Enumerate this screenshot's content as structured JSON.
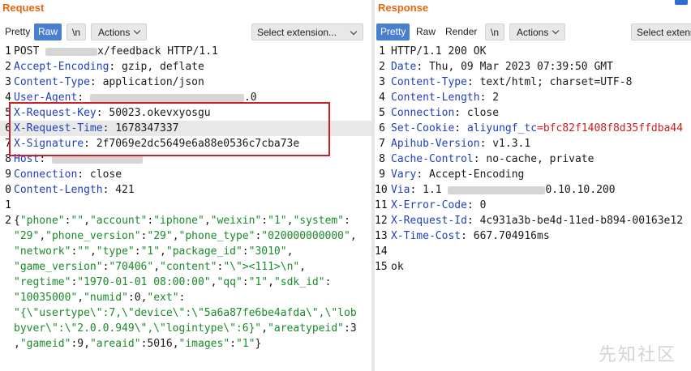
{
  "request": {
    "title": "Request",
    "tabs": [
      "Pretty",
      "Raw",
      "\\n"
    ],
    "active_tab": "Raw",
    "actions_label": "Actions",
    "select_extension": "Select extension...",
    "lines": [
      {
        "n": "1",
        "segments": [
          {
            "t": "POST ",
            "c": "hv"
          },
          {
            "t": "",
            "c": "redact",
            "w": 64
          },
          {
            "t": "x/feedback HTTP/1.1",
            "c": "hv"
          }
        ]
      },
      {
        "n": "2",
        "segments": [
          {
            "t": "Accept-Encoding",
            "c": "hk"
          },
          {
            "t": ": gzip, deflate",
            "c": "hv"
          }
        ]
      },
      {
        "n": "3",
        "segments": [
          {
            "t": "Content-Type",
            "c": "hk"
          },
          {
            "t": ": application/json",
            "c": "hv"
          }
        ]
      },
      {
        "n": "4",
        "segments": [
          {
            "t": "User-Agent",
            "c": "hk"
          },
          {
            "t": ": ",
            "c": "hv"
          },
          {
            "t": "",
            "c": "redact",
            "w": 190
          },
          {
            "t": ".0",
            "c": "hv"
          }
        ]
      },
      {
        "n": "5",
        "segments": [
          {
            "t": "X-Request-Key",
            "c": "hk"
          },
          {
            "t": ": 50023.okevxyosgu",
            "c": "hv"
          }
        ]
      },
      {
        "n": "6",
        "hl": true,
        "segments": [
          {
            "t": "X-Request-Time",
            "c": "hk"
          },
          {
            "t": ": 1678347337",
            "c": "hv"
          }
        ]
      },
      {
        "n": "7",
        "segments": [
          {
            "t": "X-Signature",
            "c": "hk"
          },
          {
            "t": ": 2f7069e2dc5649e6a88e0536c7cba73e",
            "c": "hv"
          }
        ]
      },
      {
        "n": "8",
        "segments": [
          {
            "t": "Host",
            "c": "hk"
          },
          {
            "t": ": ",
            "c": "hv"
          },
          {
            "t": "",
            "c": "redact",
            "w": 112
          }
        ]
      },
      {
        "n": "9",
        "segments": [
          {
            "t": "Connection",
            "c": "hk"
          },
          {
            "t": ": close",
            "c": "hv"
          }
        ]
      },
      {
        "n": "0",
        "segments": [
          {
            "t": "Content-Length",
            "c": "hk"
          },
          {
            "t": ": 421",
            "c": "hv"
          }
        ]
      },
      {
        "n": "1",
        "segments": []
      },
      {
        "n": "2",
        "segments": [
          {
            "t": "{",
            "c": "jp"
          },
          {
            "t": "\"phone\"",
            "c": "jk"
          },
          {
            "t": ":",
            "c": "jp"
          },
          {
            "t": "\"\"",
            "c": "js"
          },
          {
            "t": ",",
            "c": "jp"
          },
          {
            "t": "\"account\"",
            "c": "jk"
          },
          {
            "t": ":",
            "c": "jp"
          },
          {
            "t": "\"iphone\"",
            "c": "js"
          },
          {
            "t": ",",
            "c": "jp"
          },
          {
            "t": "\"weixin\"",
            "c": "jk"
          },
          {
            "t": ":",
            "c": "jp"
          },
          {
            "t": "\"1\"",
            "c": "js"
          },
          {
            "t": ",",
            "c": "jp"
          },
          {
            "t": "\"system\"",
            "c": "jk"
          },
          {
            "t": ":",
            "c": "jp"
          }
        ]
      },
      {
        "n": "",
        "segments": [
          {
            "t": "\"29\"",
            "c": "js"
          },
          {
            "t": ",",
            "c": "jp"
          },
          {
            "t": "\"phone_version\"",
            "c": "jk"
          },
          {
            "t": ":",
            "c": "jp"
          },
          {
            "t": "\"29\"",
            "c": "js"
          },
          {
            "t": ",",
            "c": "jp"
          },
          {
            "t": "\"phone_type\"",
            "c": "jk"
          },
          {
            "t": ":",
            "c": "jp"
          },
          {
            "t": "\"020000000000\"",
            "c": "js"
          },
          {
            "t": ",",
            "c": "jp"
          }
        ]
      },
      {
        "n": "",
        "segments": [
          {
            "t": "\"network\"",
            "c": "jk"
          },
          {
            "t": ":",
            "c": "jp"
          },
          {
            "t": "\"\"",
            "c": "js"
          },
          {
            "t": ",",
            "c": "jp"
          },
          {
            "t": "\"type\"",
            "c": "jk"
          },
          {
            "t": ":",
            "c": "jp"
          },
          {
            "t": "\"1\"",
            "c": "js"
          },
          {
            "t": ",",
            "c": "jp"
          },
          {
            "t": "\"package_id\"",
            "c": "jk"
          },
          {
            "t": ":",
            "c": "jp"
          },
          {
            "t": "\"3010\"",
            "c": "js"
          },
          {
            "t": ",",
            "c": "jp"
          }
        ]
      },
      {
        "n": "",
        "segments": [
          {
            "t": "\"game_version\"",
            "c": "jk"
          },
          {
            "t": ":",
            "c": "jp"
          },
          {
            "t": "\"70406\"",
            "c": "js"
          },
          {
            "t": ",",
            "c": "jp"
          },
          {
            "t": "\"content\"",
            "c": "jk"
          },
          {
            "t": ":",
            "c": "jp"
          },
          {
            "t": "\"\\\"><111>\\n\"",
            "c": "js"
          },
          {
            "t": ",",
            "c": "jp"
          }
        ]
      },
      {
        "n": "",
        "segments": [
          {
            "t": "\"regtime\"",
            "c": "jk"
          },
          {
            "t": ":",
            "c": "jp"
          },
          {
            "t": "\"1970-01-01 08:00:00\"",
            "c": "js"
          },
          {
            "t": ",",
            "c": "jp"
          },
          {
            "t": "\"qq\"",
            "c": "jk"
          },
          {
            "t": ":",
            "c": "jp"
          },
          {
            "t": "\"1\"",
            "c": "js"
          },
          {
            "t": ",",
            "c": "jp"
          },
          {
            "t": "\"sdk_id\"",
            "c": "jk"
          },
          {
            "t": ":",
            "c": "jp"
          }
        ]
      },
      {
        "n": "",
        "segments": [
          {
            "t": "\"10035000\"",
            "c": "js"
          },
          {
            "t": ",",
            "c": "jp"
          },
          {
            "t": "\"numid\"",
            "c": "jk"
          },
          {
            "t": ":",
            "c": "jp"
          },
          {
            "t": "0",
            "c": "jn"
          },
          {
            "t": ",",
            "c": "jp"
          },
          {
            "t": "\"ext\"",
            "c": "jk"
          },
          {
            "t": ":",
            "c": "jp"
          }
        ]
      },
      {
        "n": "",
        "segments": [
          {
            "t": "\"{\\\"usertype\\\":7,\\\"device\\\":\\\"5a6a87fe6be4afda\\\",\\\"lob",
            "c": "js"
          }
        ]
      },
      {
        "n": "",
        "segments": [
          {
            "t": "byver\\\":\\\"2.0.0.949\\\",\\\"logintype\\\":6}\"",
            "c": "js"
          },
          {
            "t": ",",
            "c": "jp"
          },
          {
            "t": "\"areatypeid\"",
            "c": "jk"
          },
          {
            "t": ":3",
            "c": "jp"
          }
        ]
      },
      {
        "n": "",
        "segments": [
          {
            "t": ",",
            "c": "jp"
          },
          {
            "t": "\"gameid\"",
            "c": "jk"
          },
          {
            "t": ":9,",
            "c": "jp"
          },
          {
            "t": "\"areaid\"",
            "c": "jk"
          },
          {
            "t": ":5016,",
            "c": "jp"
          },
          {
            "t": "\"images\"",
            "c": "jk"
          },
          {
            "t": ":",
            "c": "jp"
          },
          {
            "t": "\"1\"",
            "c": "js"
          },
          {
            "t": "}",
            "c": "jp"
          }
        ]
      }
    ]
  },
  "response": {
    "title": "Response",
    "tabs": [
      "Pretty",
      "Raw",
      "Render",
      "\\n"
    ],
    "active_tab": "Pretty",
    "actions_label": "Actions",
    "select_extension": "Select extens",
    "lines": [
      {
        "n": "1",
        "segments": [
          {
            "t": "HTTP/1.1 200 OK",
            "c": "hv"
          }
        ]
      },
      {
        "n": "2",
        "segments": [
          {
            "t": "Date",
            "c": "hk"
          },
          {
            "t": ": Thu, 09 Mar 2023 07:39:50 GMT",
            "c": "hv"
          }
        ]
      },
      {
        "n": "3",
        "segments": [
          {
            "t": "Content-Type",
            "c": "hk"
          },
          {
            "t": ": text/html; charset=UTF-8",
            "c": "hv"
          }
        ]
      },
      {
        "n": "4",
        "segments": [
          {
            "t": "Content-Length",
            "c": "hk"
          },
          {
            "t": ": 2",
            "c": "hv"
          }
        ]
      },
      {
        "n": "5",
        "segments": [
          {
            "t": "Connection",
            "c": "hk"
          },
          {
            "t": ": close",
            "c": "hv"
          }
        ]
      },
      {
        "n": "6",
        "segments": [
          {
            "t": "Set-Cookie",
            "c": "hk"
          },
          {
            "t": ": ",
            "c": "hv"
          },
          {
            "t": "aliyungf_tc",
            "c": "hk"
          },
          {
            "t": "=bfc82f1408f8d35ffdba44",
            "c": "red"
          }
        ]
      },
      {
        "n": "7",
        "segments": [
          {
            "t": "Apihub-Version",
            "c": "hk"
          },
          {
            "t": ": v1.3.1",
            "c": "hv"
          }
        ]
      },
      {
        "n": "8",
        "segments": [
          {
            "t": "Cache-Control",
            "c": "hk"
          },
          {
            "t": ": no-cache, private",
            "c": "hv"
          }
        ]
      },
      {
        "n": "9",
        "segments": [
          {
            "t": "Vary",
            "c": "hk"
          },
          {
            "t": ": Accept-Encoding",
            "c": "hv"
          }
        ]
      },
      {
        "n": "10",
        "segments": [
          {
            "t": "Via",
            "c": "hk"
          },
          {
            "t": ": 1.1 ",
            "c": "hv"
          },
          {
            "t": "",
            "c": "redact",
            "w": 120
          },
          {
            "t": "0.10.10.200",
            "c": "hv"
          }
        ]
      },
      {
        "n": "11",
        "segments": [
          {
            "t": "X-Error-Code",
            "c": "hk"
          },
          {
            "t": ": 0",
            "c": "hv"
          }
        ]
      },
      {
        "n": "12",
        "segments": [
          {
            "t": "X-Request-Id",
            "c": "hk"
          },
          {
            "t": ": 4c931a3b-be4d-11ed-b894-00163e12",
            "c": "hv"
          }
        ]
      },
      {
        "n": "13",
        "segments": [
          {
            "t": "X-Time-Cost",
            "c": "hk"
          },
          {
            "t": ": 667.704916ms",
            "c": "hv"
          }
        ]
      },
      {
        "n": "14",
        "segments": []
      },
      {
        "n": "15",
        "segments": [
          {
            "t": "ok",
            "c": "hv"
          }
        ]
      }
    ]
  },
  "watermark": "先知社区"
}
